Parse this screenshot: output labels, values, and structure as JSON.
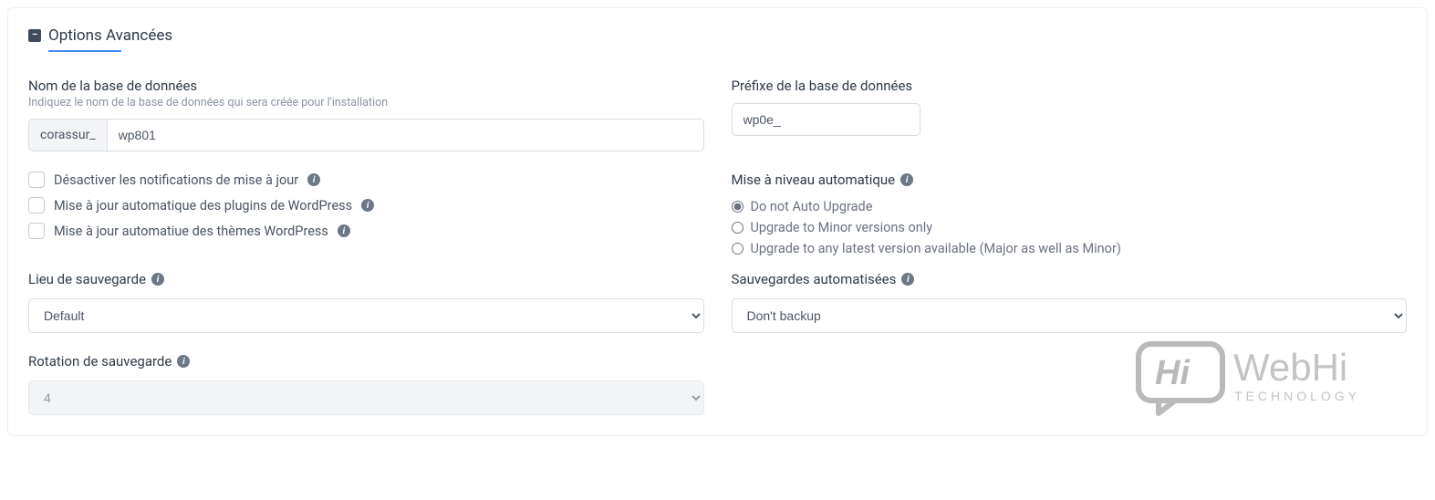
{
  "header": {
    "title": "Options Avancées"
  },
  "db": {
    "name_label": "Nom de la base de données",
    "name_help": "Indiquez le nom de la base de données qui sera créée pour l'installation",
    "name_prefix": "corassur_",
    "name_value": "wp801",
    "prefix_label": "Préfixe de la base de données",
    "prefix_value": "wp0e_"
  },
  "checks": {
    "disable_update_notif": "Désactiver les notifications de mise à jour",
    "auto_update_plugins": "Mise à jour automatique des plugins de WordPress",
    "auto_update_themes": "Mise à jour automatiue des thèmes WordPress"
  },
  "upgrade": {
    "label": "Mise à niveau automatique",
    "opt_none": "Do not Auto Upgrade",
    "opt_minor": "Upgrade to Minor versions only",
    "opt_any": "Upgrade to any latest version available (Major as well as Minor)"
  },
  "backup": {
    "location_label": "Lieu de sauvegarde",
    "location_value": "Default",
    "auto_label": "Sauvegardes automatisées",
    "auto_value": "Don't backup",
    "rotation_label": "Rotation de sauvegarde",
    "rotation_value": "4"
  },
  "watermark": {
    "brand_main": "WebHi",
    "brand_sub": "TECHNOLOGY",
    "bubble": "Hi"
  }
}
